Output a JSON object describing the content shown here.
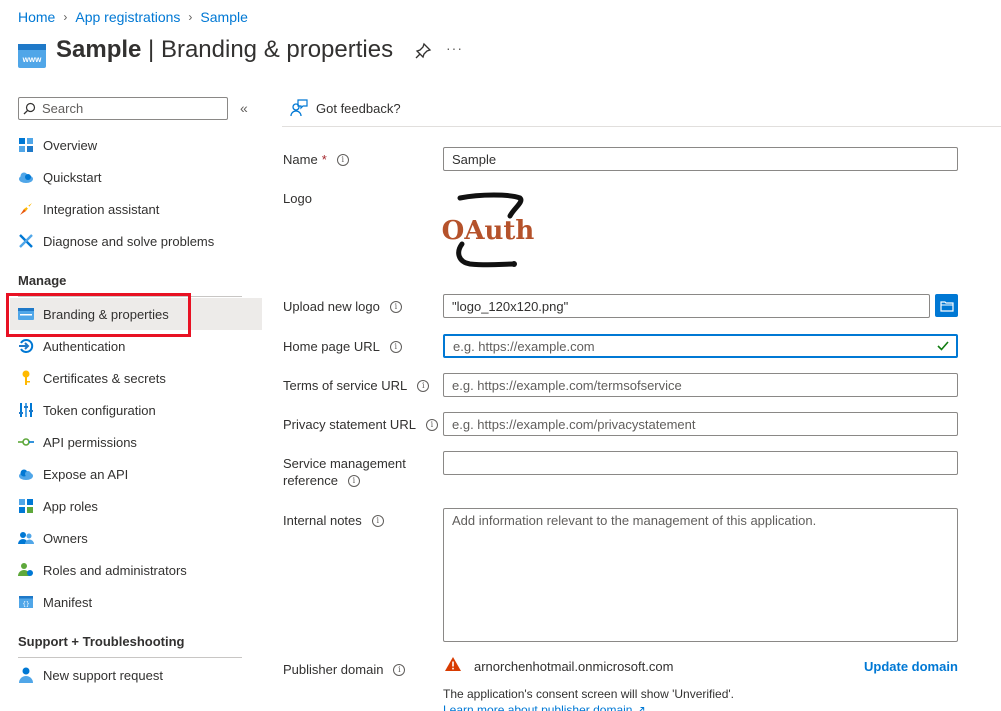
{
  "breadcrumb": [
    "Home",
    "App registrations",
    "Sample"
  ],
  "header": {
    "app_name": "Sample",
    "separator": " | ",
    "page_name": "Branding & properties",
    "more": "···"
  },
  "sidebar": {
    "search_placeholder": "Search",
    "collapse": "«",
    "top_items": [
      {
        "label": "Overview",
        "icon": "overview-grid-icon"
      },
      {
        "label": "Quickstart",
        "icon": "cloud-icon"
      },
      {
        "label": "Integration assistant",
        "icon": "rocket-icon"
      },
      {
        "label": "Diagnose and solve problems",
        "icon": "wrench-icon"
      }
    ],
    "manage_heading": "Manage",
    "manage_items": [
      {
        "label": "Branding & properties",
        "icon": "branding-icon"
      },
      {
        "label": "Authentication",
        "icon": "authentication-icon"
      },
      {
        "label": "Certificates & secrets",
        "icon": "key-icon"
      },
      {
        "label": "Token configuration",
        "icon": "token-bars-icon"
      },
      {
        "label": "API permissions",
        "icon": "api-permissions-icon"
      },
      {
        "label": "Expose an API",
        "icon": "cloud-api-icon"
      },
      {
        "label": "App roles",
        "icon": "app-roles-grid-icon"
      },
      {
        "label": "Owners",
        "icon": "owners-people-icon"
      },
      {
        "label": "Roles and administrators",
        "icon": "roles-person-icon"
      },
      {
        "label": "Manifest",
        "icon": "manifest-icon"
      }
    ],
    "support_heading": "Support + Troubleshooting",
    "support_items": [
      {
        "label": "New support request",
        "icon": "support-person-icon"
      }
    ]
  },
  "main": {
    "feedback": "Got feedback?",
    "name_label": "Name",
    "name_required": "*",
    "name_value": "Sample",
    "logo_label": "Logo",
    "logo_text": "OAuth",
    "upload_label": "Upload new logo",
    "upload_value": "\"logo_120x120.png\"",
    "homepage_label": "Home page URL",
    "homepage_placeholder": "e.g. https://example.com",
    "tos_label": "Terms of service URL",
    "tos_placeholder": "e.g. https://example.com/termsofservice",
    "privacy_label": "Privacy statement URL",
    "privacy_placeholder": "e.g. https://example.com/privacystatement",
    "service_label_line1": "Service management",
    "service_label_line2": "reference",
    "service_value": "",
    "notes_label": "Internal notes",
    "notes_placeholder": "Add information relevant to the management of this application.",
    "publisher_label": "Publisher domain",
    "publisher_value": "arnorchenhotmail.onmicrosoft.com",
    "update_domain": "Update domain",
    "consent_note": "The application's consent screen will show 'Unverified'.",
    "learn_more": "Learn more about publisher domain"
  },
  "colors": {
    "accent": "#0078d4",
    "highlight": "#e81123",
    "warning": "#d83b01",
    "logo_brown": "#b5522b"
  }
}
